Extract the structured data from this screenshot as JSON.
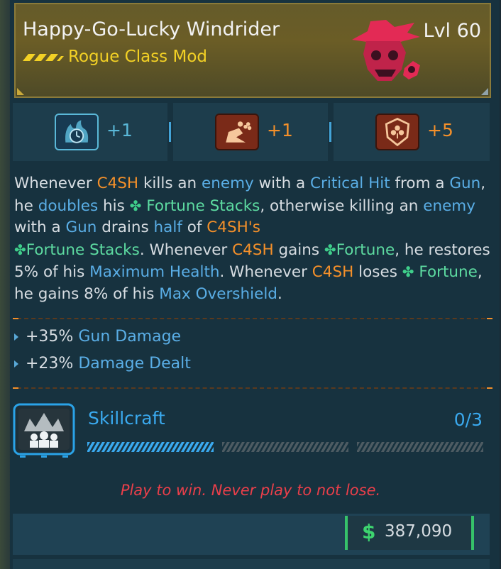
{
  "item": {
    "name": "Happy-Go-Lucky Windrider",
    "level": "Lvl 60",
    "subtitle": "Rogue Class Mod",
    "class_emblem_icon": "red-outlaw-skull-with-spider-icon",
    "rarity_icon": "yellow-chevron-rarity-icon"
  },
  "perks": [
    {
      "icon": "fortune-clock-flame-icon",
      "count": "+1",
      "color": "#5ab8d8"
    },
    {
      "icon": "sliding-figure-clover-icon",
      "count": "+1",
      "color": "#f4902a"
    },
    {
      "icon": "clover-shield-icon",
      "count": "+5",
      "color": "#f4902a"
    }
  ],
  "description": {
    "p1": "Whenever ",
    "c4sh1": "C4SH",
    "p2": " kills an ",
    "enemy1": "enemy",
    "p3": " with a ",
    "crit": "Critical Hit",
    "p4": " from a ",
    "gun1": "Gun",
    "p5": ", he ",
    "doubles": "doubles",
    "p6": " his ",
    "fortune_stacks1": "Fortune Stacks",
    "p7": ", otherwise killing an ",
    "enemy2": "enemy",
    "p8": " with a ",
    "gun2": "Gun",
    "p9": " drains ",
    "half": "half",
    "p10": " of ",
    "c4sh2": "C4SH's",
    "fortune_stacks2": "Fortune Stacks",
    "p11": ". Whenever ",
    "c4sh3": "C4SH",
    "p12": " gains ",
    "fortune1": "Fortune",
    "p13": ", he restores 5% of his ",
    "max_health": "Maximum Health",
    "p14": ". Whenever ",
    "c4sh4": "C4SH",
    "p15": " loses ",
    "fortune2": "Fortune",
    "p16": ", he gains 8% of his ",
    "max_overshield": "Max Overshield",
    "p17": "."
  },
  "stats": [
    {
      "value": "+35% ",
      "label": "Gun Damage"
    },
    {
      "value": "+23% ",
      "label": "Damage Dealt"
    }
  ],
  "skillcraft": {
    "label": "Skillcraft",
    "count": "0/3",
    "icon": "crowned-figures-skillcraft-icon",
    "progress": 0
  },
  "flavor_text": "Play to win. Never play to not lose.",
  "price": {
    "currency_symbol": "$",
    "value": "387,090"
  },
  "colors": {
    "accent_orange": "#f4902a",
    "accent_blue": "#5aaee6",
    "accent_green": "#5ddba1",
    "rarity_yellow": "#f3d125",
    "flavor_red": "#ea3f4a",
    "money_green": "#3dd46f"
  }
}
